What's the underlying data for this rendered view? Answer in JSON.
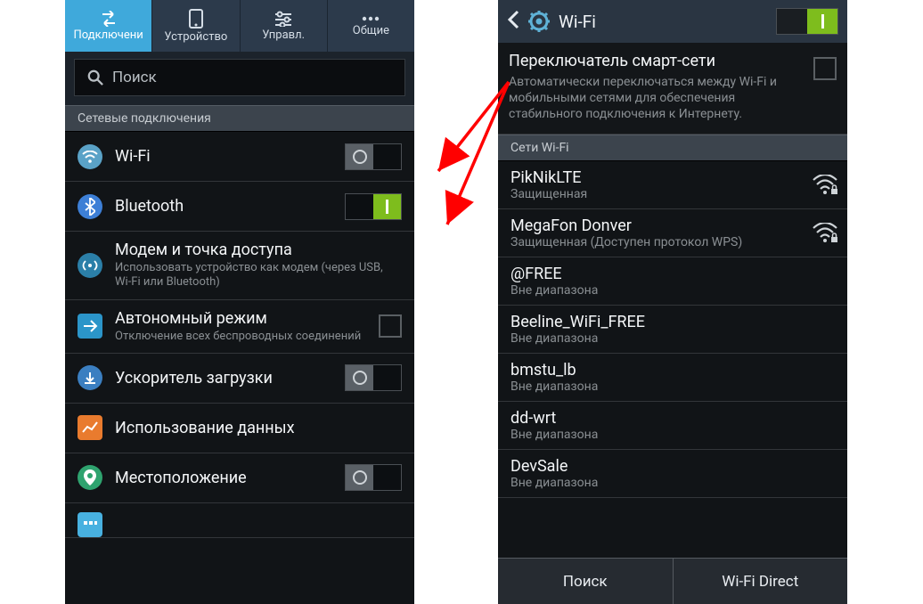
{
  "left": {
    "tabs": [
      {
        "label": "Подключени"
      },
      {
        "label": "Устройство"
      },
      {
        "label": "Управл."
      },
      {
        "label": "Общие"
      }
    ],
    "search_placeholder": "Поиск",
    "section_header": "Сетевые подключения",
    "items": {
      "wifi": {
        "title": "Wi-Fi"
      },
      "bluetooth": {
        "title": "Bluetooth"
      },
      "tether": {
        "title": "Модем и точка доступа",
        "sub": "Использовать устройство как модем (через USB, Wi-Fi или Bluetooth)"
      },
      "airplane": {
        "title": "Автономный режим",
        "sub": "Отключение всех беспроводных соединений"
      },
      "booster": {
        "title": "Ускоритель загрузки"
      },
      "data": {
        "title": "Использование данных"
      },
      "location": {
        "title": "Местоположение"
      },
      "other": {
        "title": ""
      }
    }
  },
  "right": {
    "title": "Wi-Fi",
    "smart": {
      "title": "Переключатель смарт-сети",
      "sub": "Автоматически переключаться между Wi-Fi и мобильными сетями для обеспечения стабильного подключения к Интернету."
    },
    "section_header": "Сети Wi-Fi",
    "networks": [
      {
        "name": "PikNikLTE",
        "sub": "Защищенная",
        "signal": true,
        "lock": true
      },
      {
        "name": "MegaFon Donver",
        "sub": "Защищенная (Доступен протокол WPS)",
        "signal": true,
        "lock": true
      },
      {
        "name": "@FREE",
        "sub": "Вне диапазона",
        "signal": false
      },
      {
        "name": "Beeline_WiFi_FREE",
        "sub": "Вне диапазона",
        "signal": false
      },
      {
        "name": "bmstu_lb",
        "sub": "Вне диапазона",
        "signal": false
      },
      {
        "name": "dd-wrt",
        "sub": "Вне диапазона",
        "signal": false
      },
      {
        "name": "DevSale",
        "sub": "Вне диапазона",
        "signal": false
      }
    ],
    "buttons": {
      "search": "Поиск",
      "direct": "Wi-Fi Direct"
    }
  }
}
